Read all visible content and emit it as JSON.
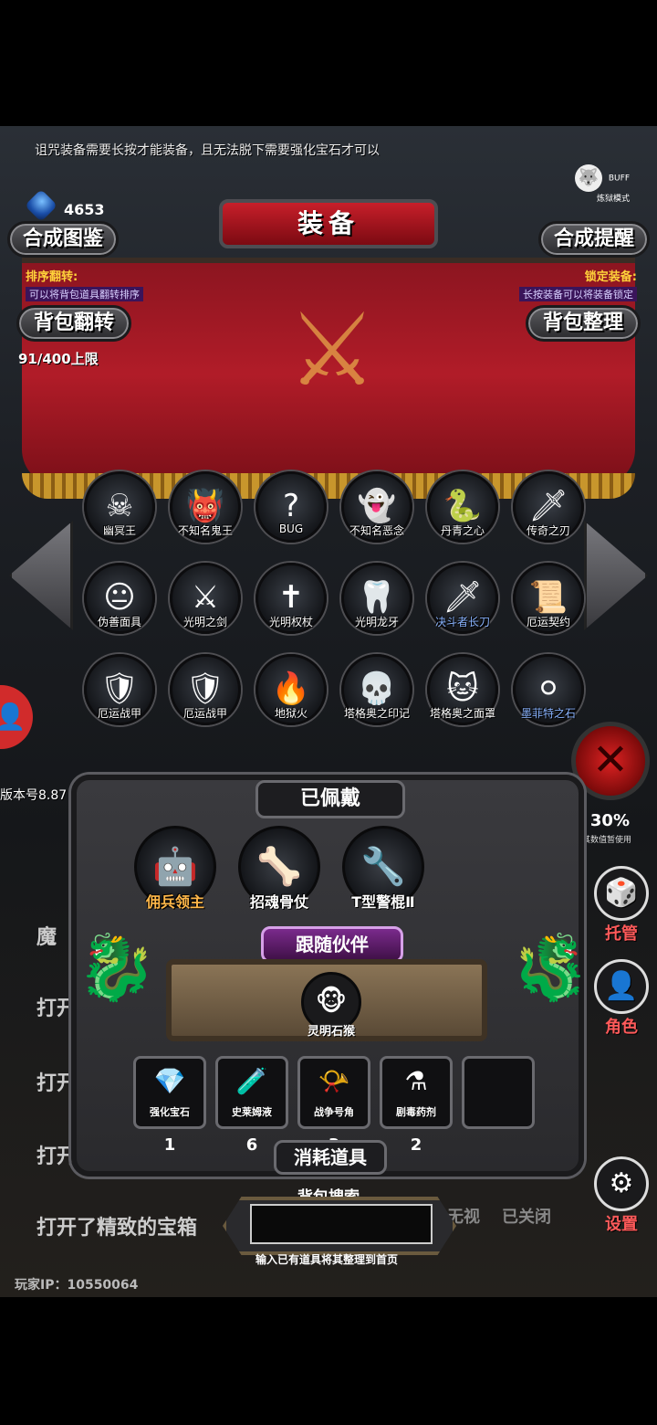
{
  "notice": "诅咒装备需要长按才能装备，且无法脱下需要强化宝石才可以",
  "currency": {
    "count": "4653",
    "icon": "blue-gem-icon"
  },
  "buff": {
    "label": "BUFF",
    "mode": "炼狱模式"
  },
  "header": {
    "title": "装备",
    "left_button": "合成图鉴",
    "right_button": "合成提醒"
  },
  "sort": {
    "label": "排序翻转:",
    "desc": "可以将背包道具翻转排序",
    "button": "背包翻转"
  },
  "lock": {
    "label": "锁定装备:",
    "desc": "长按装备可以将装备锁定",
    "button": "背包整理"
  },
  "capacity": "91/400上限",
  "inventory": [
    {
      "name": "幽冥王",
      "icon": "☠"
    },
    {
      "name": "不知名鬼王",
      "icon": "👹"
    },
    {
      "name": "BUG",
      "icon": "?"
    },
    {
      "name": "不知名恶念",
      "icon": "👻"
    },
    {
      "name": "丹青之心",
      "icon": "🐍"
    },
    {
      "name": "传奇之刃",
      "icon": "🗡"
    },
    {
      "name": "伪善面具",
      "icon": "😐"
    },
    {
      "name": "光明之剑",
      "icon": "⚔"
    },
    {
      "name": "光明权杖",
      "icon": "✝"
    },
    {
      "name": "光明龙牙",
      "icon": "🦷"
    },
    {
      "name": "决斗者长刀",
      "icon": "🗡"
    },
    {
      "name": "厄运契约",
      "icon": "📜"
    },
    {
      "name": "厄运战甲",
      "icon": "🛡"
    },
    {
      "name": "厄运战甲",
      "icon": "🛡"
    },
    {
      "name": "地狱火",
      "icon": "🔥"
    },
    {
      "name": "塔格奥之印记",
      "icon": "💀"
    },
    {
      "name": "塔格奥之面罩",
      "icon": "🐱"
    },
    {
      "name": "墨菲特之石",
      "icon": "⚪"
    }
  ],
  "version": "版本号8.87",
  "right_panel": {
    "percent": "30%",
    "percent_sub": "其数值暂使用",
    "item1": "托管",
    "item2": "角色",
    "item3": "设置"
  },
  "log": [
    "魔",
    "打开了",
    "打开",
    "打开",
    "打开了精致的宝箱"
  ],
  "bottom_status": {
    "left": "无视",
    "right": "已关闭"
  },
  "player_ip": "玩家IP：10550064",
  "equipped": {
    "title": "已佩戴",
    "items": [
      {
        "name": "佣兵领主",
        "icon": "🤖"
      },
      {
        "name": "招魂骨仗",
        "icon": "🦴"
      },
      {
        "name": "T型警棍Ⅱ",
        "icon": "🔧"
      }
    ]
  },
  "companion": {
    "title": "跟随伙伴",
    "name": "灵明石猴",
    "icon": "🐵"
  },
  "consumables": {
    "title": "消耗道具",
    "items": [
      {
        "name": "强化宝石",
        "icon": "💎",
        "count": "1"
      },
      {
        "name": "史莱姆液",
        "icon": "🧪",
        "count": "6"
      },
      {
        "name": "战争号角",
        "icon": "📯",
        "count": "3"
      },
      {
        "name": "剧毒药剂",
        "icon": "⚗",
        "count": "2"
      }
    ]
  },
  "search": {
    "title": "背包搜索",
    "placeholder": "",
    "hint": "输入已有道具将其整理到首页"
  }
}
